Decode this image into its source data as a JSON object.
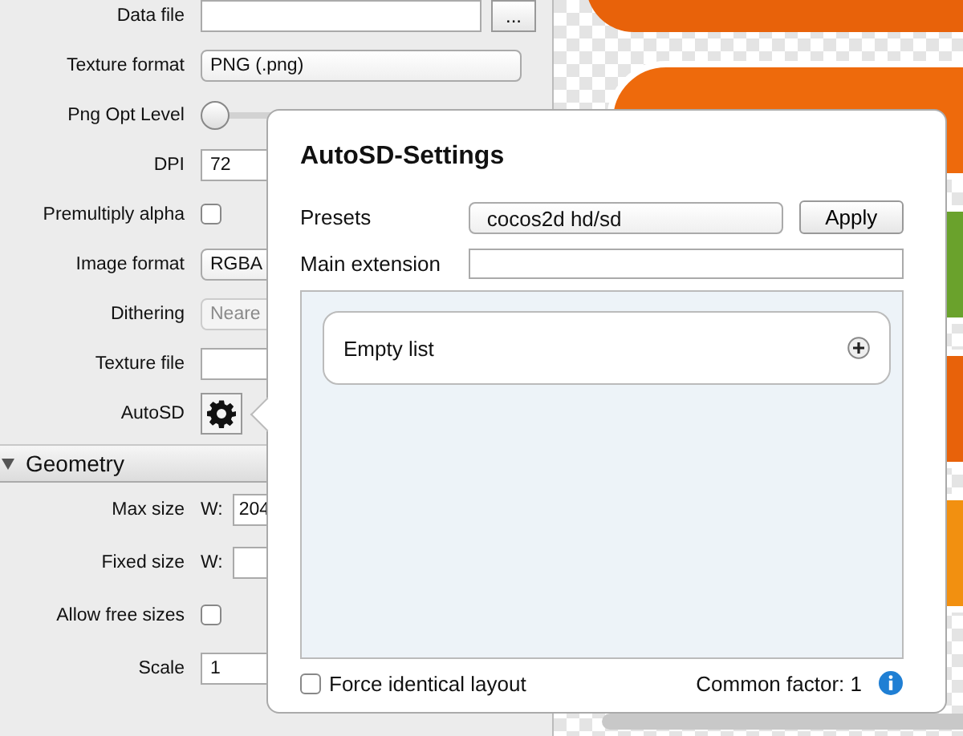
{
  "settings": [
    {
      "label": "Data file",
      "kind": "file",
      "button": "..."
    },
    {
      "label": "Texture format",
      "kind": "select",
      "value": "PNG (.png)",
      "disabled": false
    },
    {
      "label": "Png Opt Level",
      "kind": "slider",
      "level": 0
    },
    {
      "label": "DPI",
      "kind": "text",
      "value": "72"
    },
    {
      "label": "Premultiply alpha",
      "kind": "checkbox",
      "checked": false
    },
    {
      "label": "Image format",
      "kind": "select",
      "value": "RGBA",
      "disabled": false
    },
    {
      "label": "Dithering",
      "kind": "select",
      "value": "Neare",
      "disabled": true
    },
    {
      "label": "Texture file",
      "kind": "text"
    },
    {
      "label": "AutoSD",
      "kind": "gear"
    }
  ],
  "geometry": {
    "title": "Geometry",
    "expanded": true,
    "rows": [
      {
        "label": "Max size",
        "kind": "wh",
        "prefix": "W:",
        "value": "204"
      },
      {
        "label": "Fixed size",
        "kind": "wh",
        "prefix": "W:"
      },
      {
        "label": "Allow free sizes",
        "kind": "checkbox",
        "checked": false
      },
      {
        "label": "Scale",
        "kind": "text",
        "value": "1"
      }
    ]
  },
  "popover": {
    "title": "AutoSD-Settings",
    "presets_label": "Presets",
    "presets_value": "cocos2d hd/sd",
    "apply": "Apply",
    "main_extension_label": "Main extension",
    "list_empty": "Empty list",
    "force_label": "Force identical layout",
    "force_checked": false,
    "common_factor": "Common factor: 1"
  }
}
